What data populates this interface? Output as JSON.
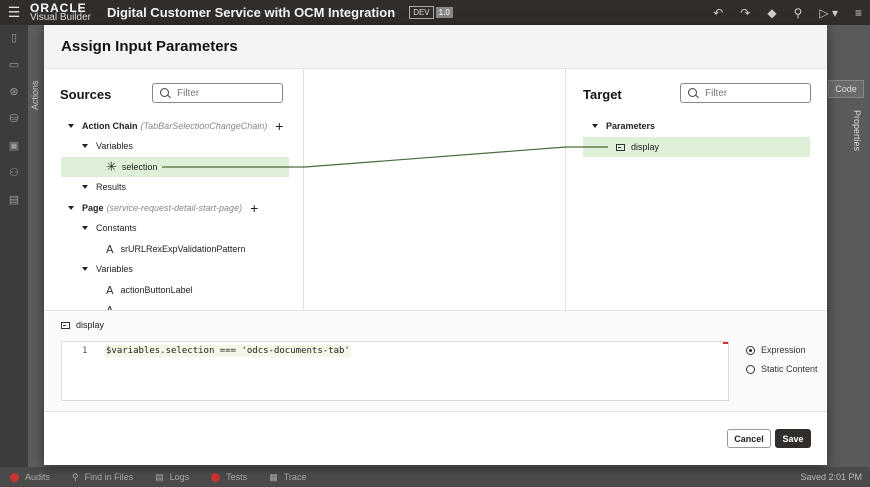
{
  "header": {
    "logo_line1": "ORACLE",
    "logo_line2": "Visual Builder",
    "app_title": "Digital Customer Service with OCM Integration",
    "env_badge": "DEV",
    "env_version": "1.0"
  },
  "background": {
    "actions_label": "Actions",
    "code_button": "Code",
    "properties_label": "Properties"
  },
  "statusbar": {
    "audits": "Audits",
    "find_in_files": "Find in Files",
    "logs": "Logs",
    "tests": "Tests",
    "trace": "Trace",
    "saved": "Saved 2:01 PM"
  },
  "modal": {
    "title": "Assign Input Parameters",
    "sources": {
      "title": "Sources",
      "filter_placeholder": "Filter",
      "action_chain_label": "Action Chain",
      "action_chain_id": "(TabBarSelectionChangeChain)",
      "variables_label": "Variables",
      "selection_label": "selection",
      "results_label": "Results",
      "page_label": "Page",
      "page_id": "(service-request-detail-start-page)",
      "constants_label": "Constants",
      "constant_item": "srURLRexExpValidationPattern",
      "page_variables_label": "Variables",
      "page_variable_item": "actionButtonLabel"
    },
    "target": {
      "title": "Target",
      "filter_placeholder": "Filter",
      "parameters_label": "Parameters",
      "display_label": "display"
    },
    "expression": {
      "field_label": "display",
      "line_number": "1",
      "code": "$variables.selection === 'odcs-documents-tab'",
      "option_expression": "Expression",
      "option_static": "Static Content",
      "selected": "Expression"
    },
    "buttons": {
      "cancel": "Cancel",
      "save": "Save"
    }
  },
  "colors": {
    "topbar": "#312d2a",
    "mapped_highlight": "#dff0d8",
    "connector": "#4a6b3a",
    "primary_button": "#312d2a"
  }
}
